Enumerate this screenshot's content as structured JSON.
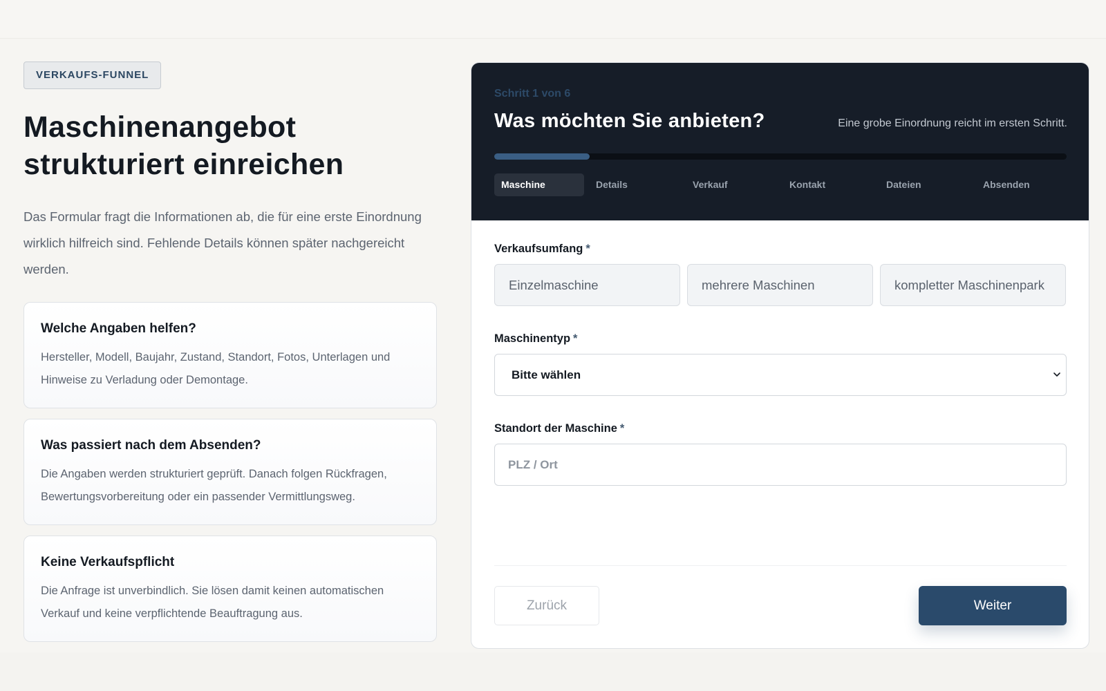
{
  "left": {
    "badge": "VERKAUFS-FUNNEL",
    "headline_line1": "Maschinenangebot",
    "headline_line2": "strukturiert einreichen",
    "intro": "Das Formular fragt die Informationen ab, die für eine erste Einordnung wirklich hilfreich sind. Fehlende Details können später nachgereicht werden.",
    "cards": [
      {
        "title": "Welche Angaben helfen?",
        "text": "Hersteller, Modell, Baujahr, Zustand, Standort, Fotos, Unterlagen und Hinweise zu Verladung oder Demontage."
      },
      {
        "title": "Was passiert nach dem Absenden?",
        "text": "Die Angaben werden strukturiert geprüft. Danach folgen Rückfragen, Bewertungsvorbereitung oder ein passender Vermittlungsweg."
      },
      {
        "title": "Keine Verkaufspflicht",
        "text": "Die Anfrage ist unverbindlich. Sie lösen damit keinen automatischen Verkauf und keine verpflichtende Beauftragung aus."
      }
    ]
  },
  "wizard": {
    "step_label": "Schritt 1 von 6",
    "title": "Was möchten Sie anbieten?",
    "hint": "Eine grobe Einordnung reicht im ersten Schritt.",
    "progress_fraction": 0.1667,
    "steps": [
      "Maschine",
      "Details",
      "Verkauf",
      "Kontakt",
      "Dateien",
      "Absenden"
    ],
    "active_step": 0
  },
  "form": {
    "scope": {
      "label": "Verkaufsumfang",
      "required_mark": "*",
      "options": [
        "Einzelmaschine",
        "mehrere Maschinen",
        "kompletter Maschinenpark"
      ]
    },
    "machine_type": {
      "label": "Maschinentyp",
      "required_mark": "*",
      "selected": "Bitte wählen"
    },
    "location": {
      "label": "Standort der Maschine",
      "required_mark": "*",
      "placeholder": "PLZ / Ort"
    },
    "back_label": "Zurück",
    "next_label": "Weiter"
  },
  "colors": {
    "accent": "#2a4a6b",
    "panel_header": "#161d28",
    "progress_fill": "#3a5e84",
    "page_background": "#f6f5f2"
  },
  "icons": {
    "select_chevron": "chevron-down-icon"
  }
}
